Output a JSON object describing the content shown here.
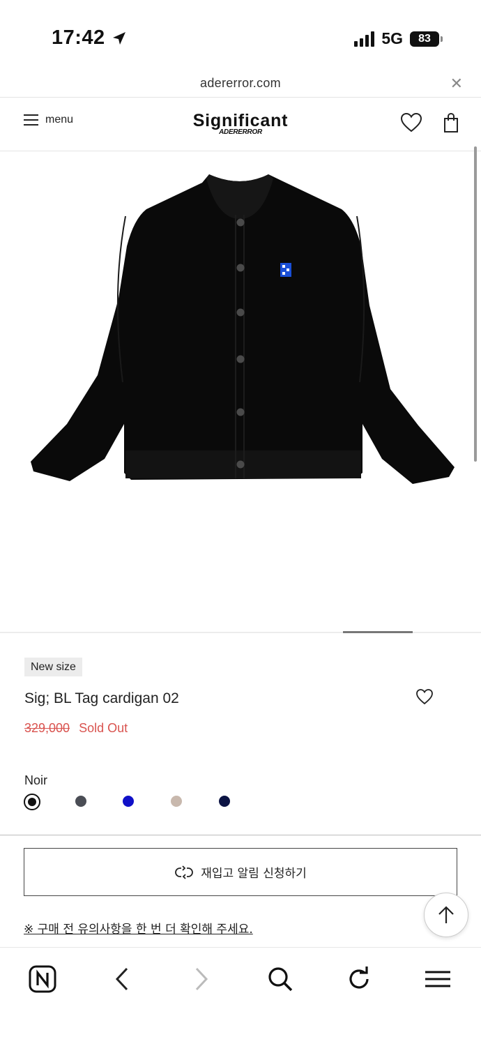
{
  "status_bar": {
    "time": "17:42",
    "network": "5G",
    "battery": "83"
  },
  "browser": {
    "url": "adererror.com"
  },
  "header": {
    "menu_label": "menu",
    "logo_main": "Significant",
    "logo_sub": "ADERERROR"
  },
  "product": {
    "badge": "New size",
    "title": "Sig; BL Tag cardigan 02",
    "original_price": "329,000",
    "status": "Sold Out",
    "selected_color": "Noir",
    "swatches": [
      "#111111",
      "#4a4d55",
      "#1010c8",
      "#c8b8ad",
      "#0c1444"
    ],
    "restock_button": "재입고 알림 신청하기",
    "notice": "※ 구매 전 유의사항을 한 번 더 확인해 주세요."
  },
  "colors": {
    "sale_red": "#d9534f",
    "logo_tag_blue": "#1a4fd6"
  },
  "icons": [
    "location-arrow-icon",
    "signal-icon",
    "battery-icon",
    "close-icon",
    "hamburger-icon",
    "heart-icon",
    "bag-icon",
    "restock-icon",
    "arrow-up-icon",
    "naver-home-icon",
    "back-icon",
    "forward-icon",
    "search-icon",
    "refresh-icon",
    "more-menu-icon"
  ]
}
